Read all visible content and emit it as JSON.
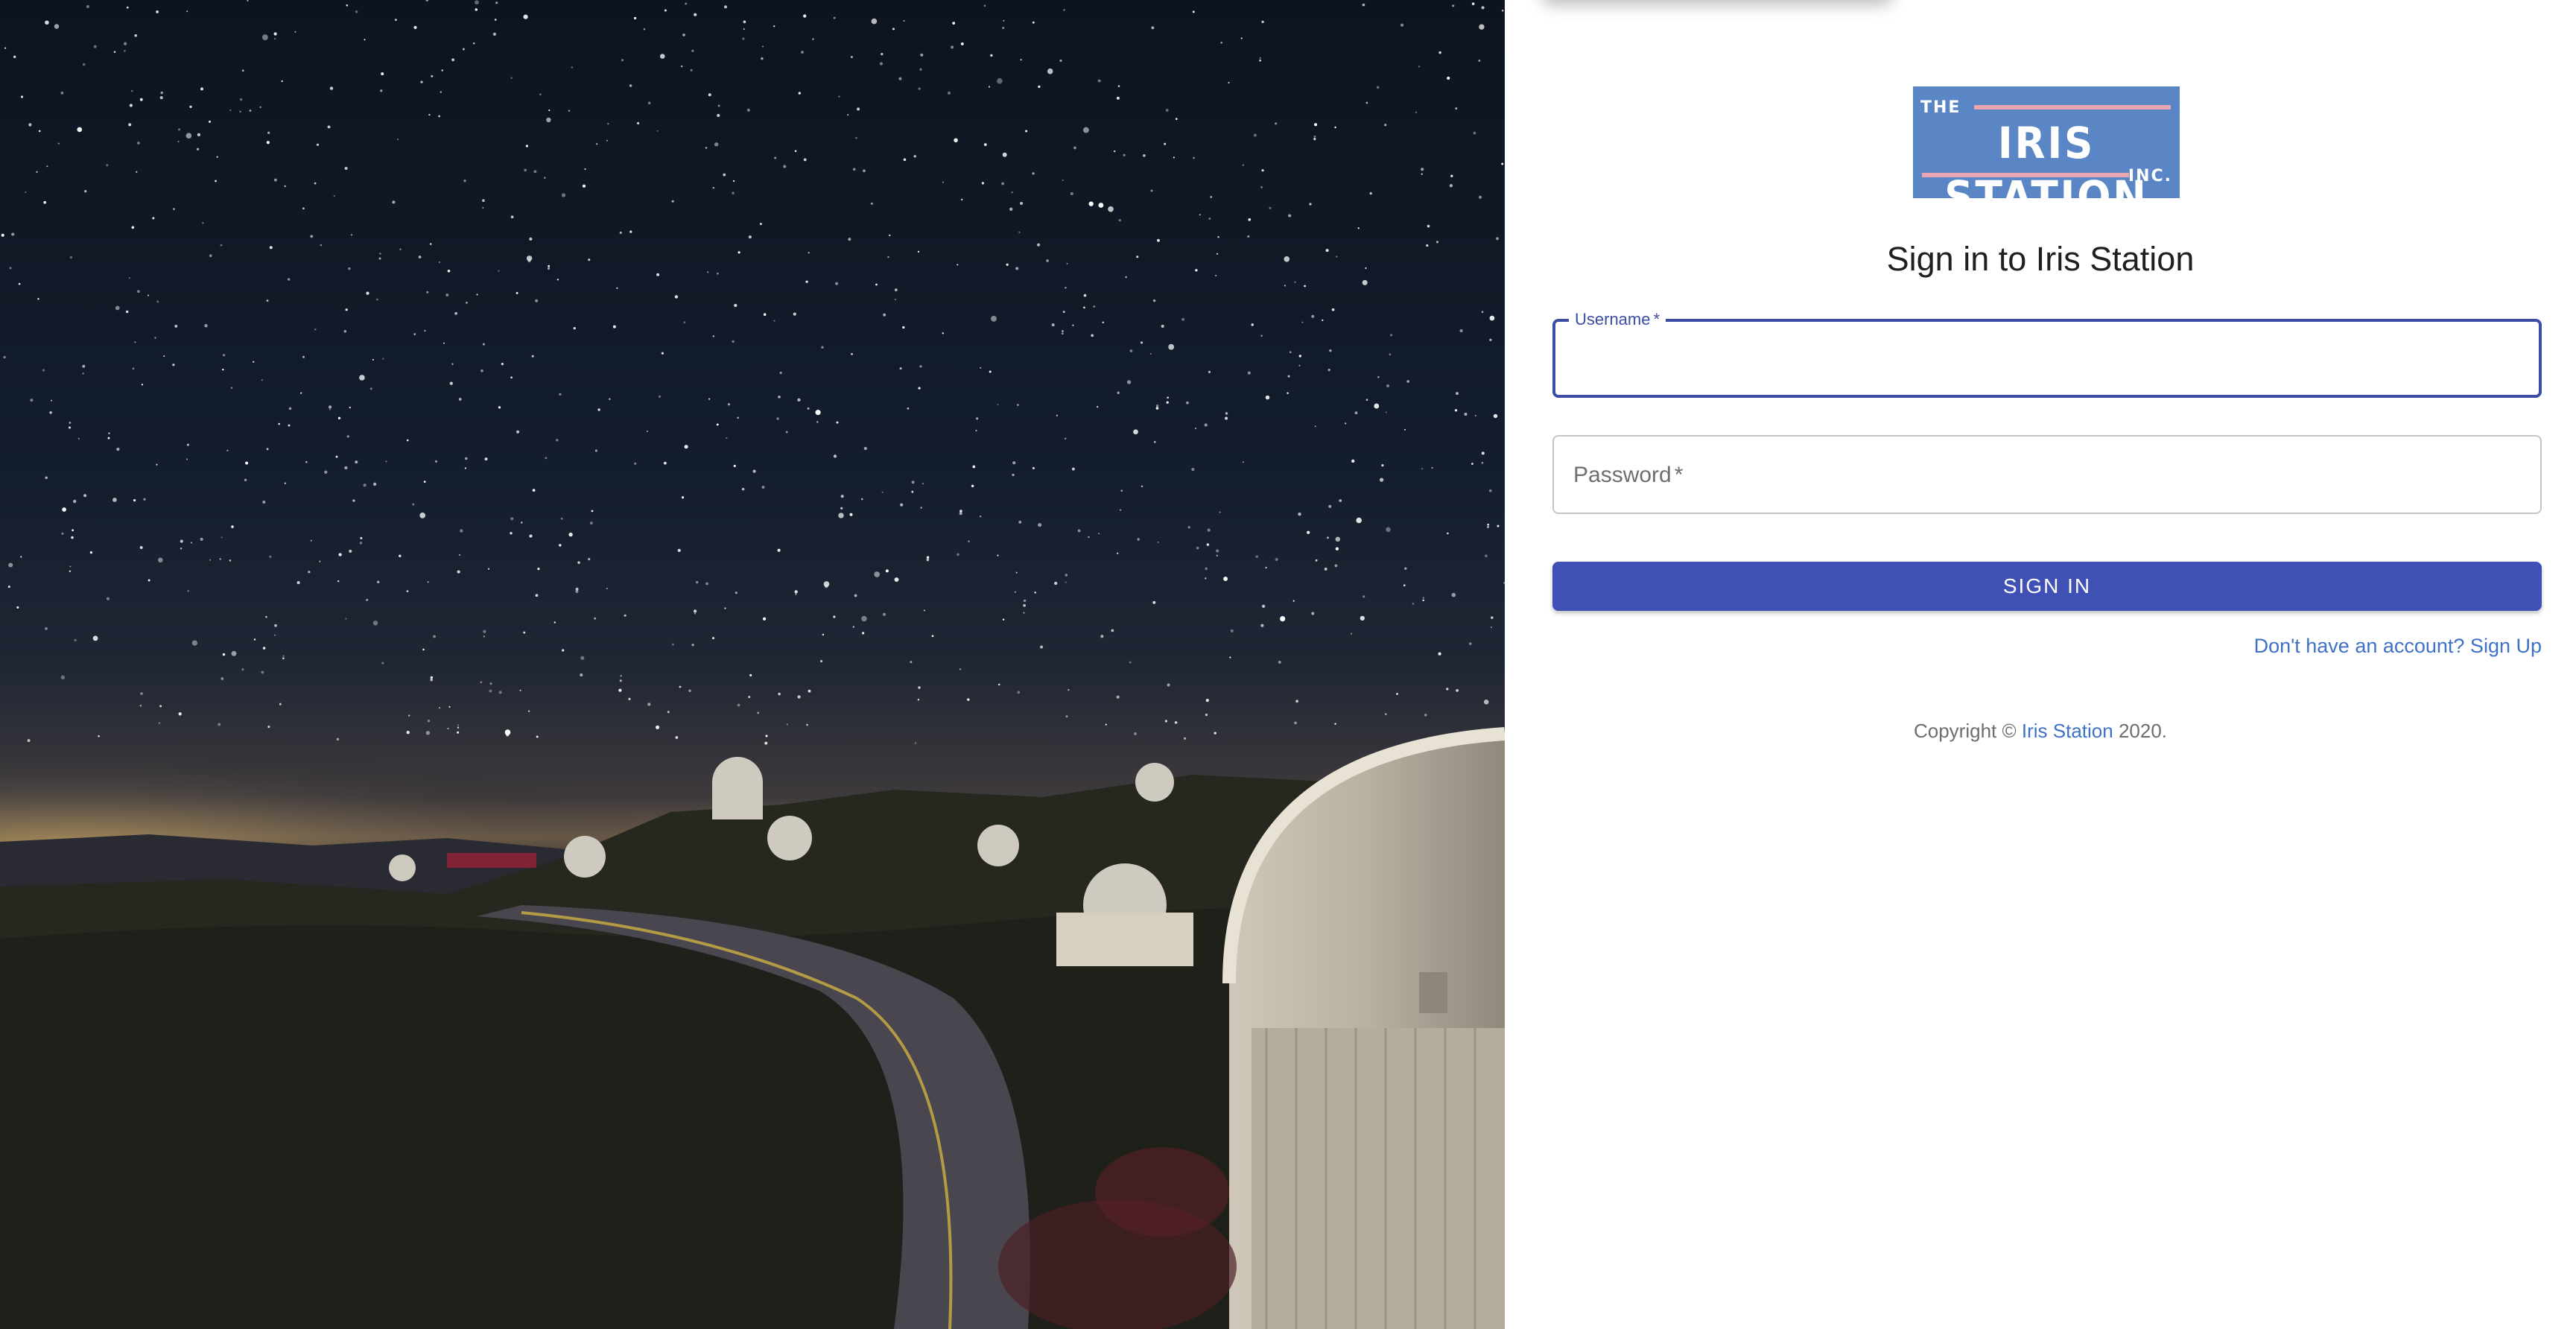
{
  "hero": {
    "image_name": "observatory-night-sky-photo"
  },
  "logo": {
    "top_text": "THE",
    "main_text": "IRIS STATION",
    "bottom_text": "INC.",
    "background_color": "#5a86c5",
    "stripe_color": "#e8a6b2"
  },
  "form": {
    "title": "Sign in to Iris Station",
    "username": {
      "label": "Username",
      "required_marker": "*",
      "value": ""
    },
    "password": {
      "label": "Password",
      "required_marker": "*",
      "value": ""
    },
    "submit_label": "SIGN IN",
    "signup_link": "Don't have an account? Sign Up"
  },
  "footer": {
    "copyright_prefix": "Copyright ©",
    "copyright_link": "Iris Station",
    "copyright_suffix": "2020."
  },
  "colors": {
    "primary": "#3f51b5",
    "focused_outline": "#3b4da4",
    "link": "#3f72c6"
  }
}
